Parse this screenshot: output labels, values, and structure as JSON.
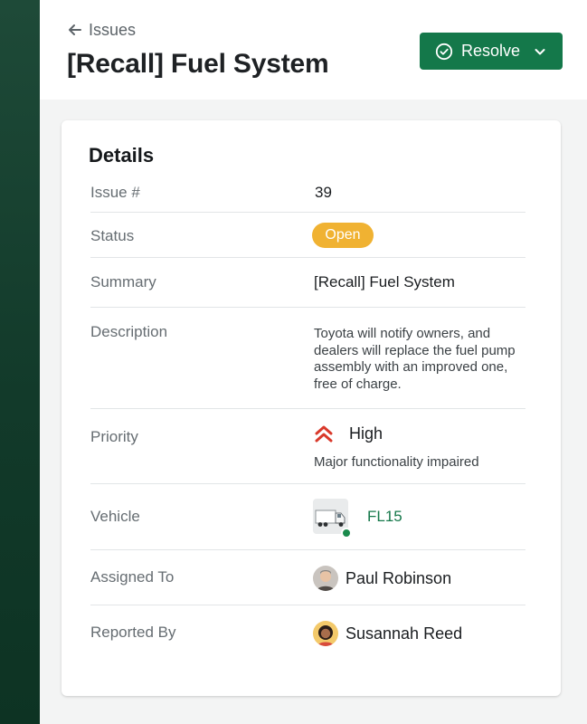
{
  "header": {
    "back_label": "Issues",
    "title": "[Recall] Fuel System",
    "resolve_label": "Resolve"
  },
  "details": {
    "heading": "Details",
    "rows": {
      "issue": {
        "label": "Issue #",
        "value": "39"
      },
      "status": {
        "label": "Status",
        "value": "Open",
        "color": "#f0b232"
      },
      "summary": {
        "label": "Summary",
        "value": "[Recall] Fuel System"
      },
      "description": {
        "label": "Description",
        "value": "Toyota will notify owners, and dealers will replace the fuel pump assembly with an improved one, free of charge."
      },
      "priority": {
        "label": "Priority",
        "value": "High",
        "subtext": "Major functionality impaired",
        "icon": "double-chevron-up-icon",
        "color": "#d9392b"
      },
      "vehicle": {
        "label": "Vehicle",
        "value": "FL15",
        "status_color": "#1a8a4c"
      },
      "assigned_to": {
        "label": "Assigned To",
        "value": "Paul Robinson"
      },
      "reported_by": {
        "label": "Reported By",
        "value": "Susannah Reed"
      }
    }
  },
  "colors": {
    "brand_green": "#14784a",
    "sidebar": "#123a2a",
    "link": "#15784a"
  }
}
